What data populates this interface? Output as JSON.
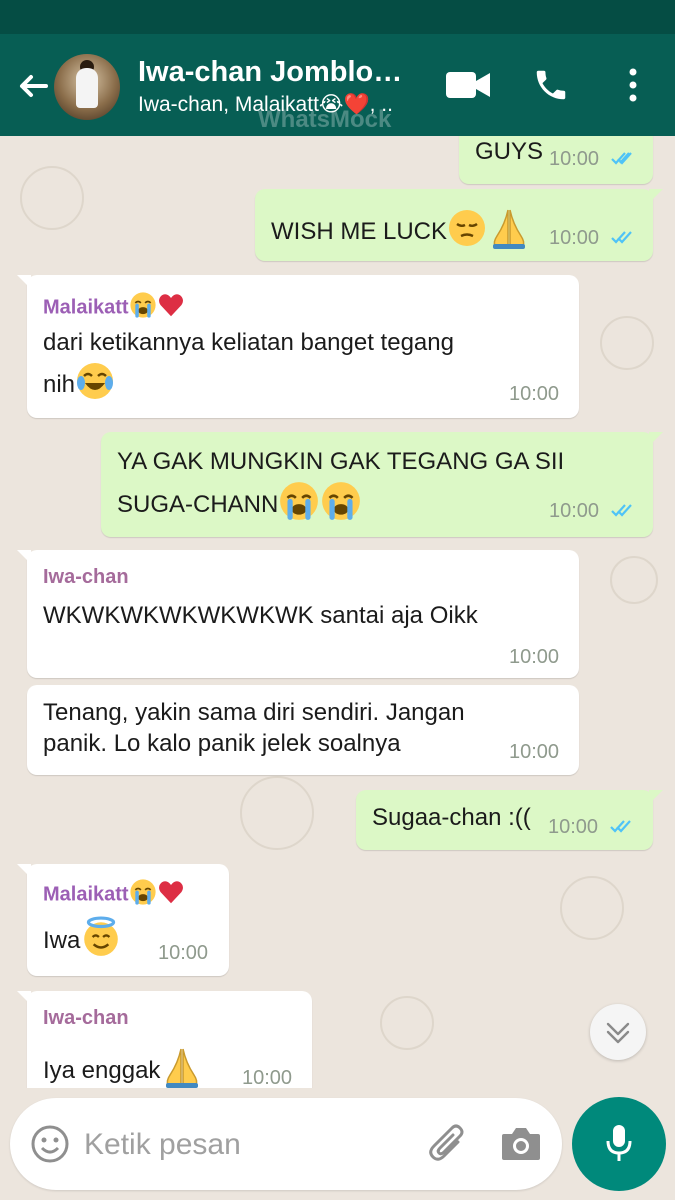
{
  "header": {
    "title": "Iwa-chan Jomblo…",
    "subtitle": "Iwa-chan, Malaikatt😭❤️, ..",
    "watermark": "WhatsMock"
  },
  "messages": [
    {
      "dir": "out",
      "text": "GUYS",
      "time": "10:00",
      "status": "read"
    },
    {
      "dir": "out",
      "text": "WISH ME LUCK",
      "emojis": [
        "pensive",
        "folded-hands"
      ],
      "time": "10:00",
      "status": "read"
    },
    {
      "dir": "in",
      "sender": "Malaikatt",
      "sender_emojis": [
        "loudly-crying",
        "red-heart"
      ],
      "lines": [
        "dari ketikannya keliatan banget tegang",
        "nih"
      ],
      "emojis": [
        "tears-of-joy"
      ],
      "time": "10:00"
    },
    {
      "dir": "out",
      "lines": [
        "YA GAK MUNGKIN GAK TEGANG GA SII",
        "SUGA-CHANN"
      ],
      "emojis": [
        "loudly-crying",
        "loudly-crying"
      ],
      "time": "10:00",
      "status": "read"
    },
    {
      "dir": "in",
      "sender": "Iwa-chan",
      "text": "WKWKWKWKWKWKWK santai aja Oikk",
      "time": "10:00"
    },
    {
      "dir": "in",
      "lines": [
        "Tenang, yakin sama diri sendiri. Jangan",
        "panik. Lo kalo panik jelek soalnya"
      ],
      "time": "10:00"
    },
    {
      "dir": "out",
      "text": "Sugaa-chan :((",
      "time": "10:00",
      "status": "read"
    },
    {
      "dir": "in",
      "sender": "Malaikatt",
      "sender_emojis": [
        "loudly-crying",
        "red-heart"
      ],
      "text": "Iwa",
      "emojis": [
        "smiling-face-with-halo"
      ],
      "time": "10:00"
    },
    {
      "dir": "in",
      "sender": "Iwa-chan",
      "text": "Iya enggak",
      "emojis": [
        "folded-hands"
      ],
      "time": "10:00"
    }
  ],
  "input": {
    "placeholder": "Ketik pesan"
  },
  "icons": [
    "back-arrow-icon",
    "video-call-icon",
    "phone-icon",
    "more-vert-icon",
    "emoji-icon",
    "attach-icon",
    "camera-icon",
    "mic-icon",
    "scroll-down-icon"
  ],
  "colors": {
    "header": "#075e54",
    "statusbar": "#054d44",
    "outgoing": "#dcf8c6",
    "incoming": "#ffffff",
    "accent": "#00897b",
    "read_ticks": "#4fc3f7",
    "sender_malaikatt": "#9c5fb5",
    "sender_iwa": "#a56b9b"
  }
}
